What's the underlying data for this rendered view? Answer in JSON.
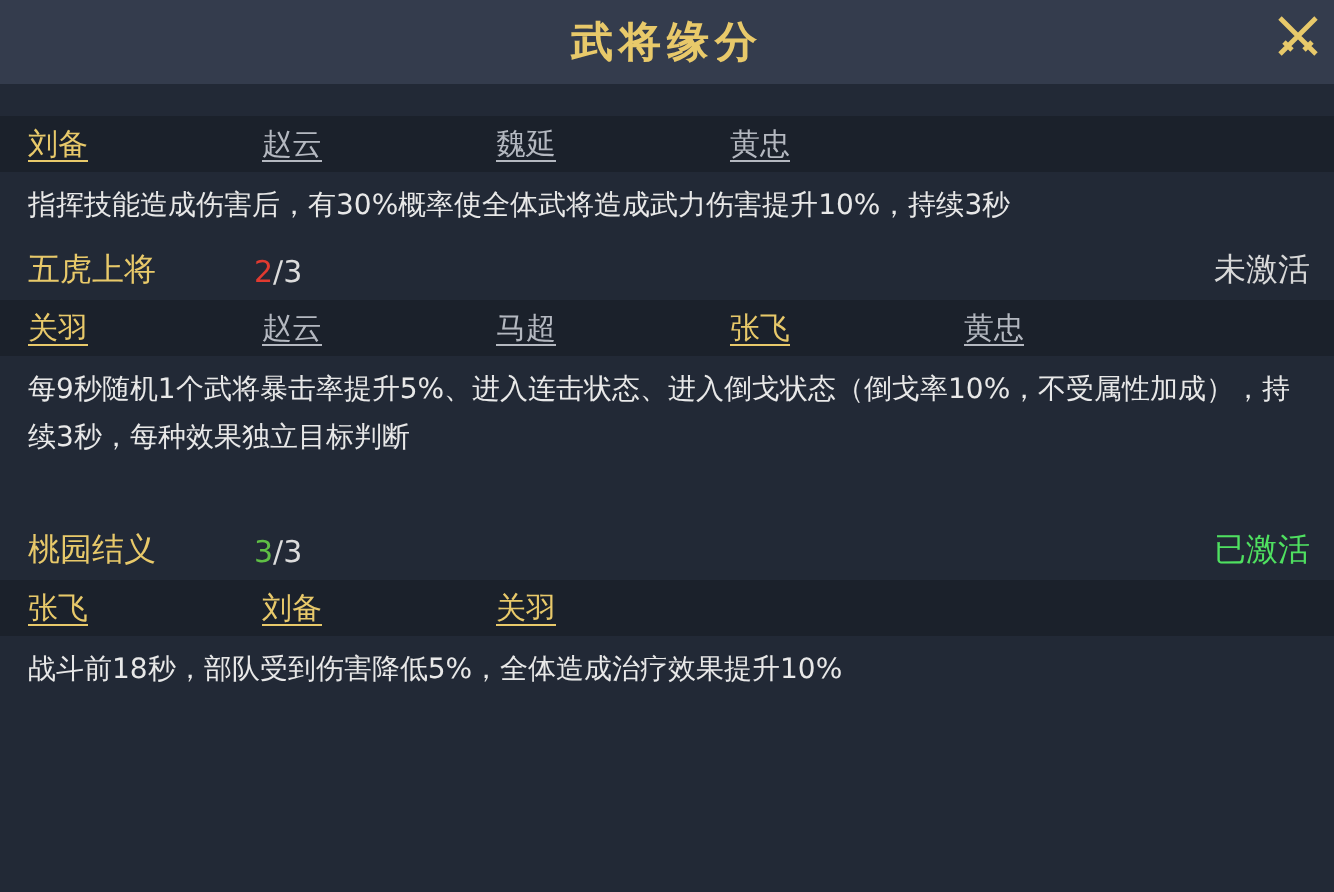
{
  "window": {
    "title": "武将缘分"
  },
  "bonds": [
    {
      "heroes": [
        {
          "name": "刘备",
          "owned": true
        },
        {
          "name": "赵云",
          "owned": false
        },
        {
          "name": "魏延",
          "owned": false
        },
        {
          "name": "黄忠",
          "owned": false
        }
      ],
      "description": "指挥技能造成伤害后，有30%概率使全体武将造成武力伤害提升10%，持续3秒"
    },
    {
      "name": "五虎上将",
      "count": "2",
      "total": "/3",
      "activated": false,
      "status": "未激活",
      "heroes": [
        {
          "name": "关羽",
          "owned": true
        },
        {
          "name": "赵云",
          "owned": false
        },
        {
          "name": "马超",
          "owned": false
        },
        {
          "name": "张飞",
          "owned": true
        },
        {
          "name": "黄忠",
          "owned": false
        }
      ],
      "description": "每9秒随机1个武将暴击率提升5%、进入连击状态、进入倒戈状态（倒戈率10%，不受属性加成），持续3秒，每种效果独立目标判断"
    },
    {
      "name": "桃园结义",
      "count": "3",
      "total": "/3",
      "activated": true,
      "status": "已激活",
      "heroes": [
        {
          "name": "张飞",
          "owned": true
        },
        {
          "name": "刘备",
          "owned": true
        },
        {
          "name": "关羽",
          "owned": true
        }
      ],
      "description": "战斗前18秒，部队受到伤害降低5%，全体造成治疗效果提升10%"
    }
  ]
}
